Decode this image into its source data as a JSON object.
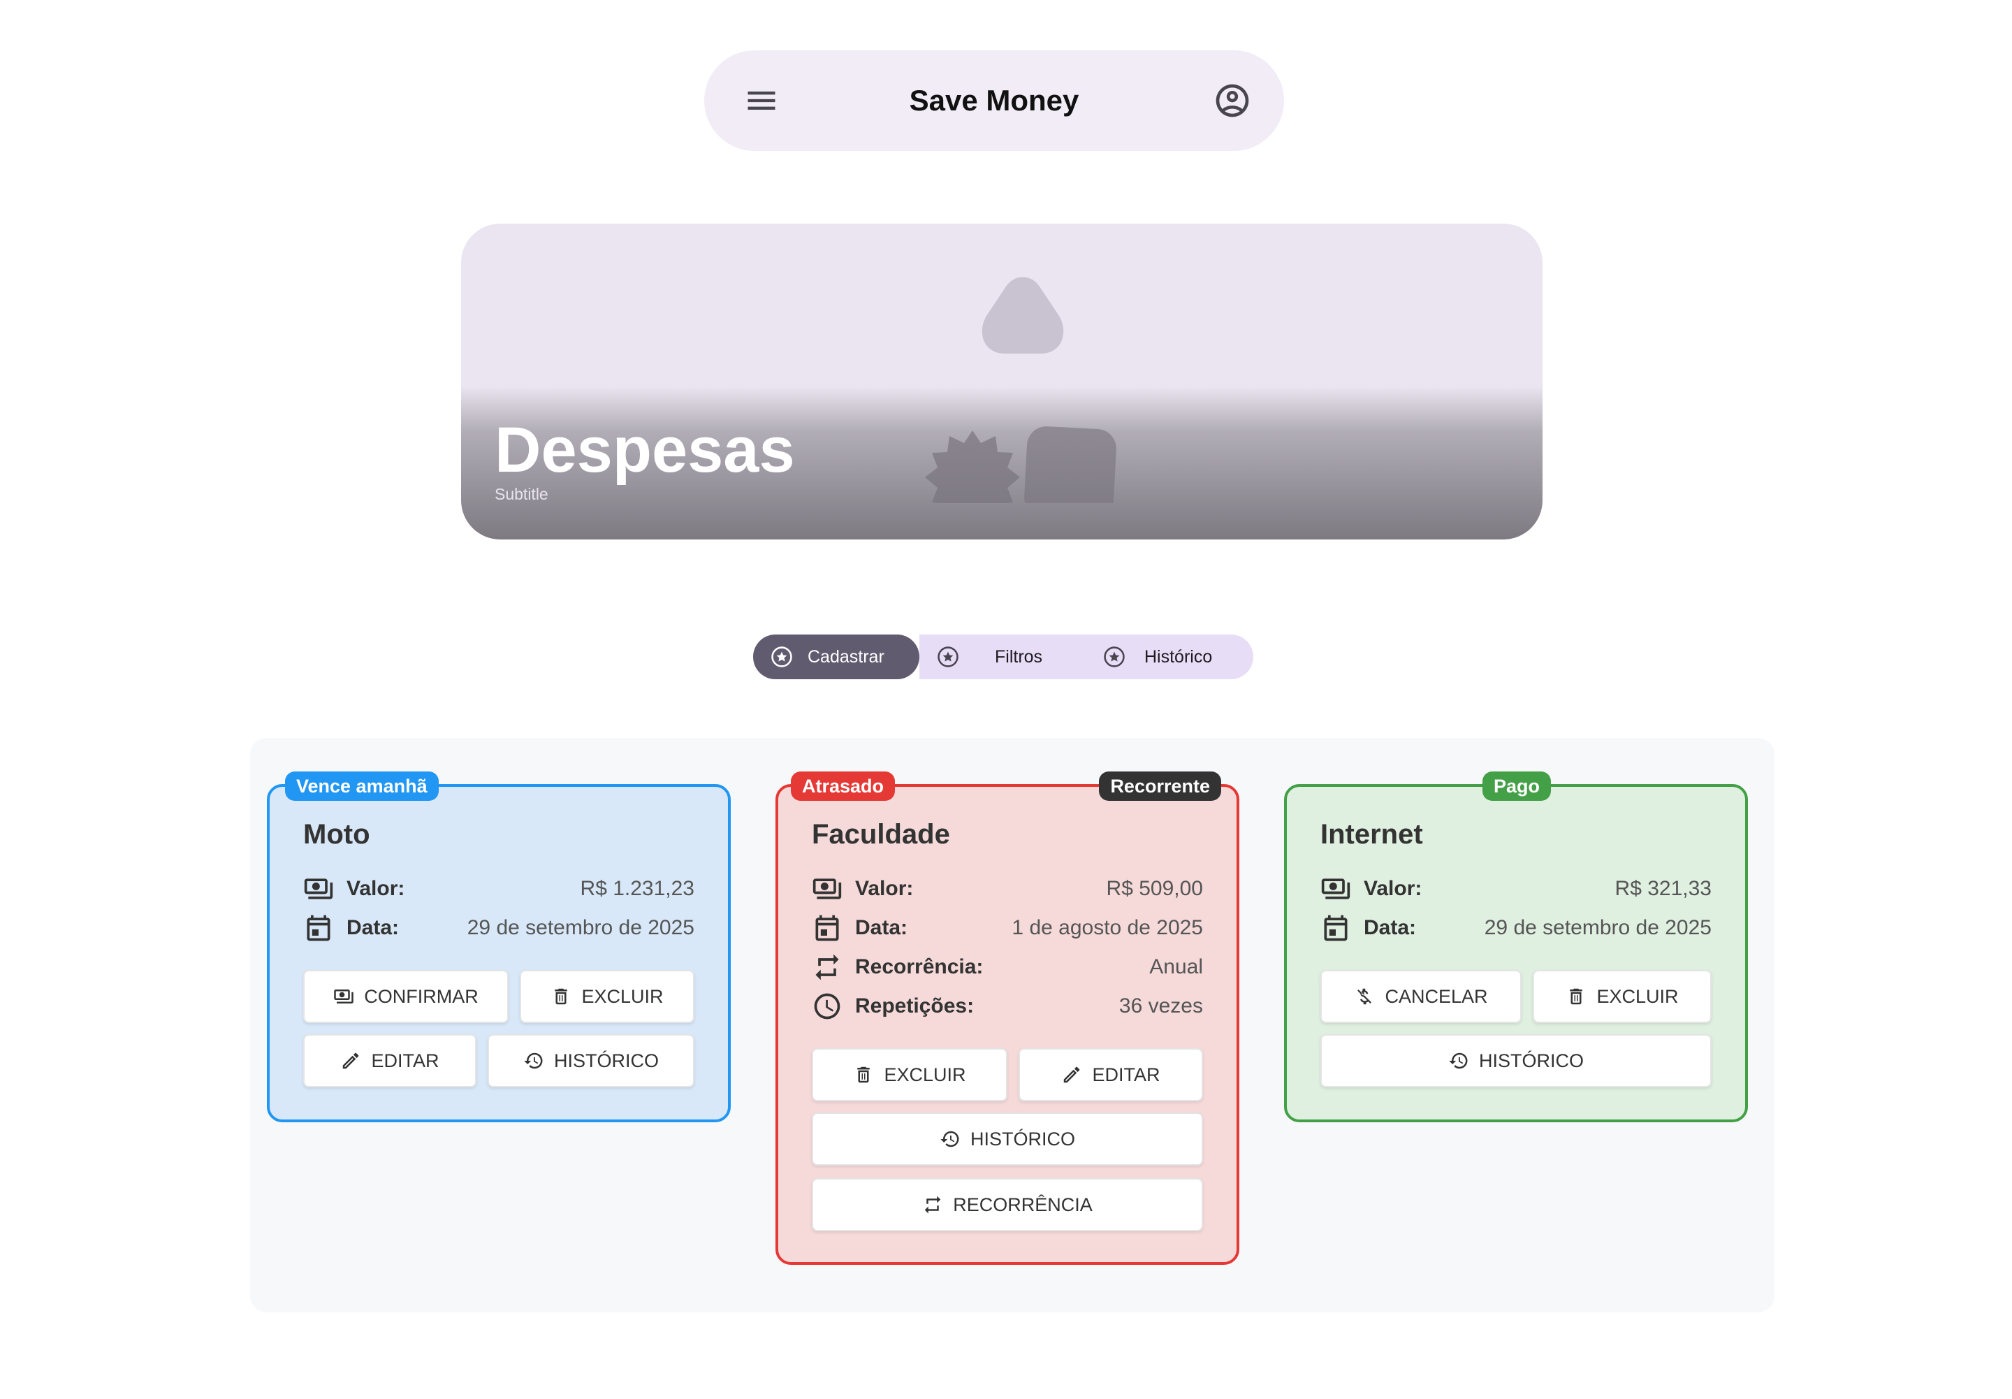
{
  "appbar": {
    "title": "Save Money",
    "menu_icon": "menu-icon",
    "account_icon": "account-circle-icon",
    "background": "#f1ecf6"
  },
  "hero": {
    "title": "Despesas",
    "subtitle": "Subtitle"
  },
  "tabs": [
    {
      "label": "Cadastrar",
      "icon": "star-circle-icon",
      "selected": true
    },
    {
      "label": "Filtros",
      "icon": "star-circle-icon",
      "selected": false
    },
    {
      "label": "Histórico",
      "icon": "star-circle-icon",
      "selected": false
    }
  ],
  "cards": [
    {
      "status": "Vence amanhã",
      "status_color": "#2196f3",
      "title": "Moto",
      "fields": [
        {
          "icon": "money-icon",
          "label": "Valor:",
          "value": "R$ 1.231,23"
        },
        {
          "icon": "calendar-icon",
          "label": "Data:",
          "value": "29 de setembro de 2025"
        }
      ],
      "buttons": {
        "confirm": "CONFIRMAR",
        "delete": "EXCLUIR",
        "edit": "EDITAR",
        "history": "HISTÓRICO"
      }
    },
    {
      "status": "Atrasado",
      "status_color": "#e53935",
      "tag": "Recorrente",
      "tag_color": "#333333",
      "title": "Faculdade",
      "fields": [
        {
          "icon": "money-icon",
          "label": "Valor:",
          "value": "R$ 509,00"
        },
        {
          "icon": "calendar-icon",
          "label": "Data:",
          "value": "1 de agosto de 2025"
        },
        {
          "icon": "repeat-icon",
          "label": "Recorrência:",
          "value": "Anual"
        },
        {
          "icon": "clock-icon",
          "label": "Repetições:",
          "value": "36 vezes"
        }
      ],
      "buttons": {
        "delete": "EXCLUIR",
        "edit": "EDITAR",
        "history": "HISTÓRICO",
        "recurrence": "RECORRÊNCIA"
      }
    },
    {
      "status": "Pago",
      "status_color": "#43a047",
      "title": "Internet",
      "fields": [
        {
          "icon": "money-icon",
          "label": "Valor:",
          "value": "R$ 321,33"
        },
        {
          "icon": "calendar-icon",
          "label": "Data:",
          "value": "29 de setembro de 2025"
        }
      ],
      "buttons": {
        "cancel": "CANCELAR",
        "delete": "EXCLUIR",
        "history": "HISTÓRICO"
      }
    }
  ]
}
